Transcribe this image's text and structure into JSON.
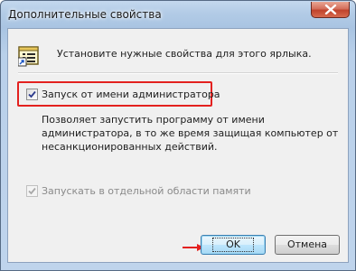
{
  "window": {
    "title": "Дополнительные свойства"
  },
  "header": {
    "text": "Установите нужные свойства для этого ярлыка."
  },
  "options": {
    "run_as_admin": {
      "label": "Запуск от имени администратора",
      "checked": true,
      "description": "Позволяет запустить программу от имени администратора, в то же время защищая компьютер от несанкционированных действий."
    },
    "separate_memory": {
      "label": "Запускать в отдельной области памяти",
      "checked": true,
      "disabled": true
    }
  },
  "buttons": {
    "ok": "OK",
    "cancel": "Отмена"
  },
  "icons": {
    "close": "close-icon",
    "shortcut": "shortcut-properties-icon",
    "arrow": "red-arrow-icon"
  },
  "colors": {
    "highlight": "#e3211f",
    "close_button": "#c0432c"
  }
}
